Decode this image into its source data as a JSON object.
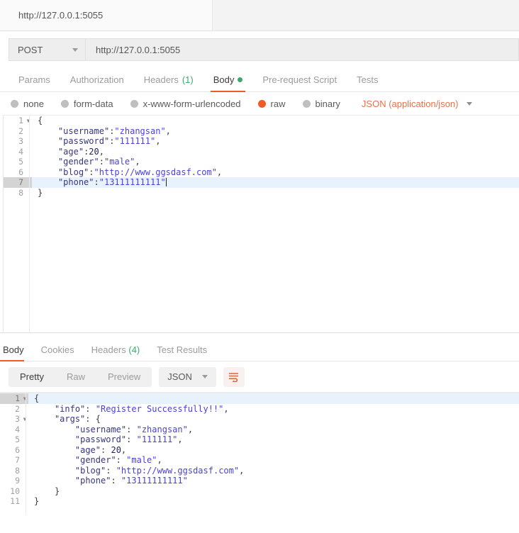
{
  "window": {
    "tab_title": "http://127.0.0.1:5055"
  },
  "request": {
    "method": "POST",
    "url": "http://127.0.0.1:5055",
    "tabs": [
      {
        "label": "Params",
        "count": "",
        "dot": false,
        "active": false
      },
      {
        "label": "Authorization",
        "count": "",
        "dot": false,
        "active": false
      },
      {
        "label": "Headers",
        "count": "(1)",
        "dot": false,
        "active": false
      },
      {
        "label": "Body",
        "count": "",
        "dot": true,
        "active": true
      },
      {
        "label": "Pre-request Script",
        "count": "",
        "dot": false,
        "active": false
      },
      {
        "label": "Tests",
        "count": "",
        "dot": false,
        "active": false
      }
    ],
    "body_types": [
      {
        "label": "none",
        "selected": false
      },
      {
        "label": "form-data",
        "selected": false
      },
      {
        "label": "x-www-form-urlencoded",
        "selected": false
      },
      {
        "label": "raw",
        "selected": true
      },
      {
        "label": "binary",
        "selected": false
      }
    ],
    "content_type": "JSON (application/json)",
    "body_lines": [
      {
        "n": "1",
        "fold": true,
        "hl": false,
        "code": "{"
      },
      {
        "n": "2",
        "fold": false,
        "hl": false,
        "code": "    \"username\":\"zhangsan\","
      },
      {
        "n": "3",
        "fold": false,
        "hl": false,
        "code": "    \"password\":\"111111\","
      },
      {
        "n": "4",
        "fold": false,
        "hl": false,
        "code": "    \"age\":20,"
      },
      {
        "n": "5",
        "fold": false,
        "hl": false,
        "code": "    \"gender\":\"male\","
      },
      {
        "n": "6",
        "fold": false,
        "hl": false,
        "code": "    \"blog\":\"http://www.ggsdasf.com\","
      },
      {
        "n": "7",
        "fold": false,
        "hl": true,
        "code": "    \"phone\":\"13111111111\""
      },
      {
        "n": "8",
        "fold": false,
        "hl": false,
        "code": "}"
      }
    ]
  },
  "response": {
    "tabs": [
      {
        "label": "Body",
        "count": "",
        "active": true
      },
      {
        "label": "Cookies",
        "count": "",
        "active": false
      },
      {
        "label": "Headers",
        "count": "(4)",
        "active": false
      },
      {
        "label": "Test Results",
        "count": "",
        "active": false
      }
    ],
    "view_modes": [
      {
        "label": "Pretty",
        "active": true
      },
      {
        "label": "Raw",
        "active": false
      },
      {
        "label": "Preview",
        "active": false
      }
    ],
    "format": "JSON",
    "wrap_icon": "word-wrap-icon",
    "body_lines": [
      {
        "n": "1",
        "fold": true,
        "hl": true,
        "code": "{"
      },
      {
        "n": "2",
        "fold": false,
        "hl": false,
        "code": "    \"info\": \"Register Successfully!!\","
      },
      {
        "n": "3",
        "fold": true,
        "hl": false,
        "code": "    \"args\": {"
      },
      {
        "n": "4",
        "fold": false,
        "hl": false,
        "code": "        \"username\": \"zhangsan\","
      },
      {
        "n": "5",
        "fold": false,
        "hl": false,
        "code": "        \"password\": \"111111\","
      },
      {
        "n": "6",
        "fold": false,
        "hl": false,
        "code": "        \"age\": 20,"
      },
      {
        "n": "7",
        "fold": false,
        "hl": false,
        "code": "        \"gender\": \"male\","
      },
      {
        "n": "8",
        "fold": false,
        "hl": false,
        "code": "        \"blog\": \"http://www.ggsdasf.com\","
      },
      {
        "n": "9",
        "fold": false,
        "hl": false,
        "code": "        \"phone\": \"13111111111\""
      },
      {
        "n": "10",
        "fold": false,
        "hl": false,
        "code": "    }"
      },
      {
        "n": "11",
        "fold": false,
        "hl": false,
        "code": "}"
      }
    ]
  },
  "colors": {
    "accent": "#ef5b25",
    "green": "#3aab6c",
    "json_key": "#36367f",
    "json_string": "#4a42d8",
    "highlight": "#e8f2fd"
  }
}
